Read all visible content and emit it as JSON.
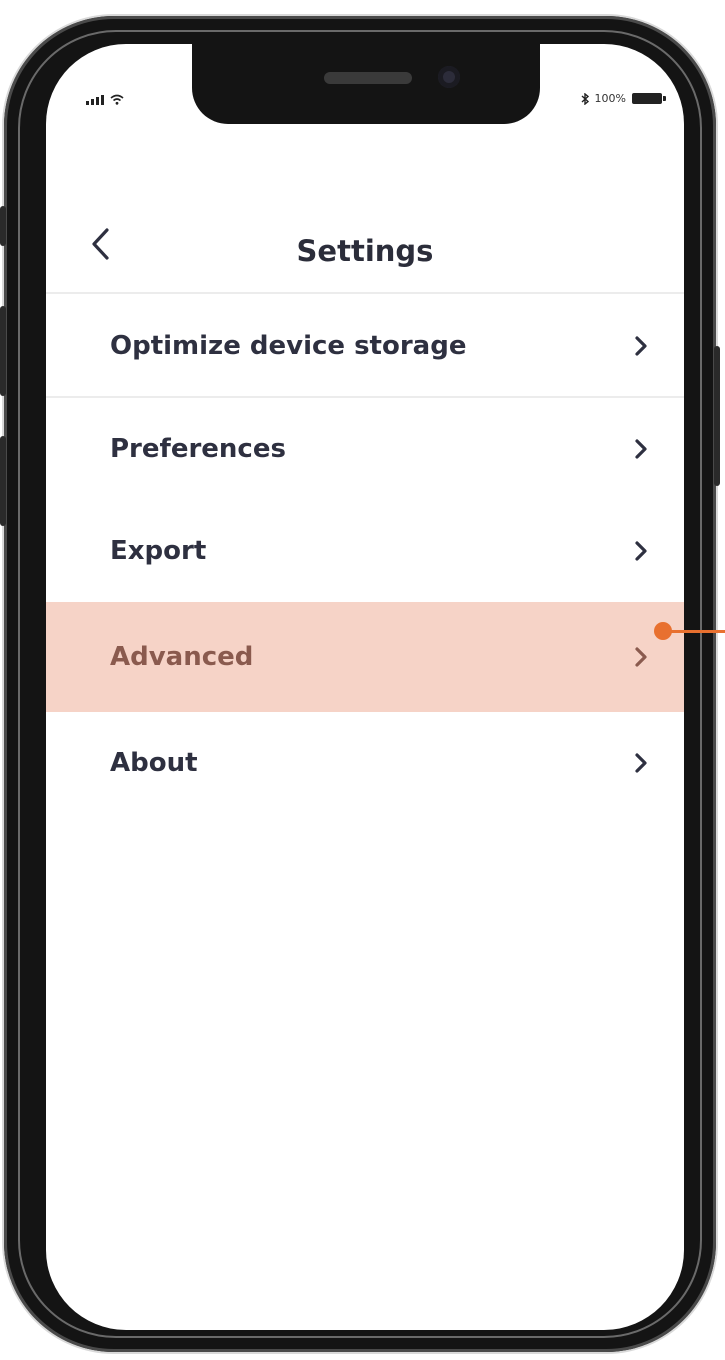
{
  "status_bar": {
    "battery_text": "100%"
  },
  "header": {
    "title": "Settings"
  },
  "menu": {
    "items": [
      {
        "label": "Optimize device storage"
      },
      {
        "label": "Preferences"
      },
      {
        "label": "Export"
      },
      {
        "label": "Advanced",
        "highlighted": true
      },
      {
        "label": "About"
      }
    ]
  },
  "colors": {
    "highlight_row": "#f6d3c7",
    "callout": "#e8702f",
    "text": "#2e3040"
  },
  "icons": {
    "back": "chevron-left-icon",
    "row_arrow": "chevron-right-icon",
    "signal": "signal-bars-icon",
    "wifi": "wifi-icon",
    "bluetooth": "bluetooth-icon",
    "battery": "battery-icon"
  }
}
